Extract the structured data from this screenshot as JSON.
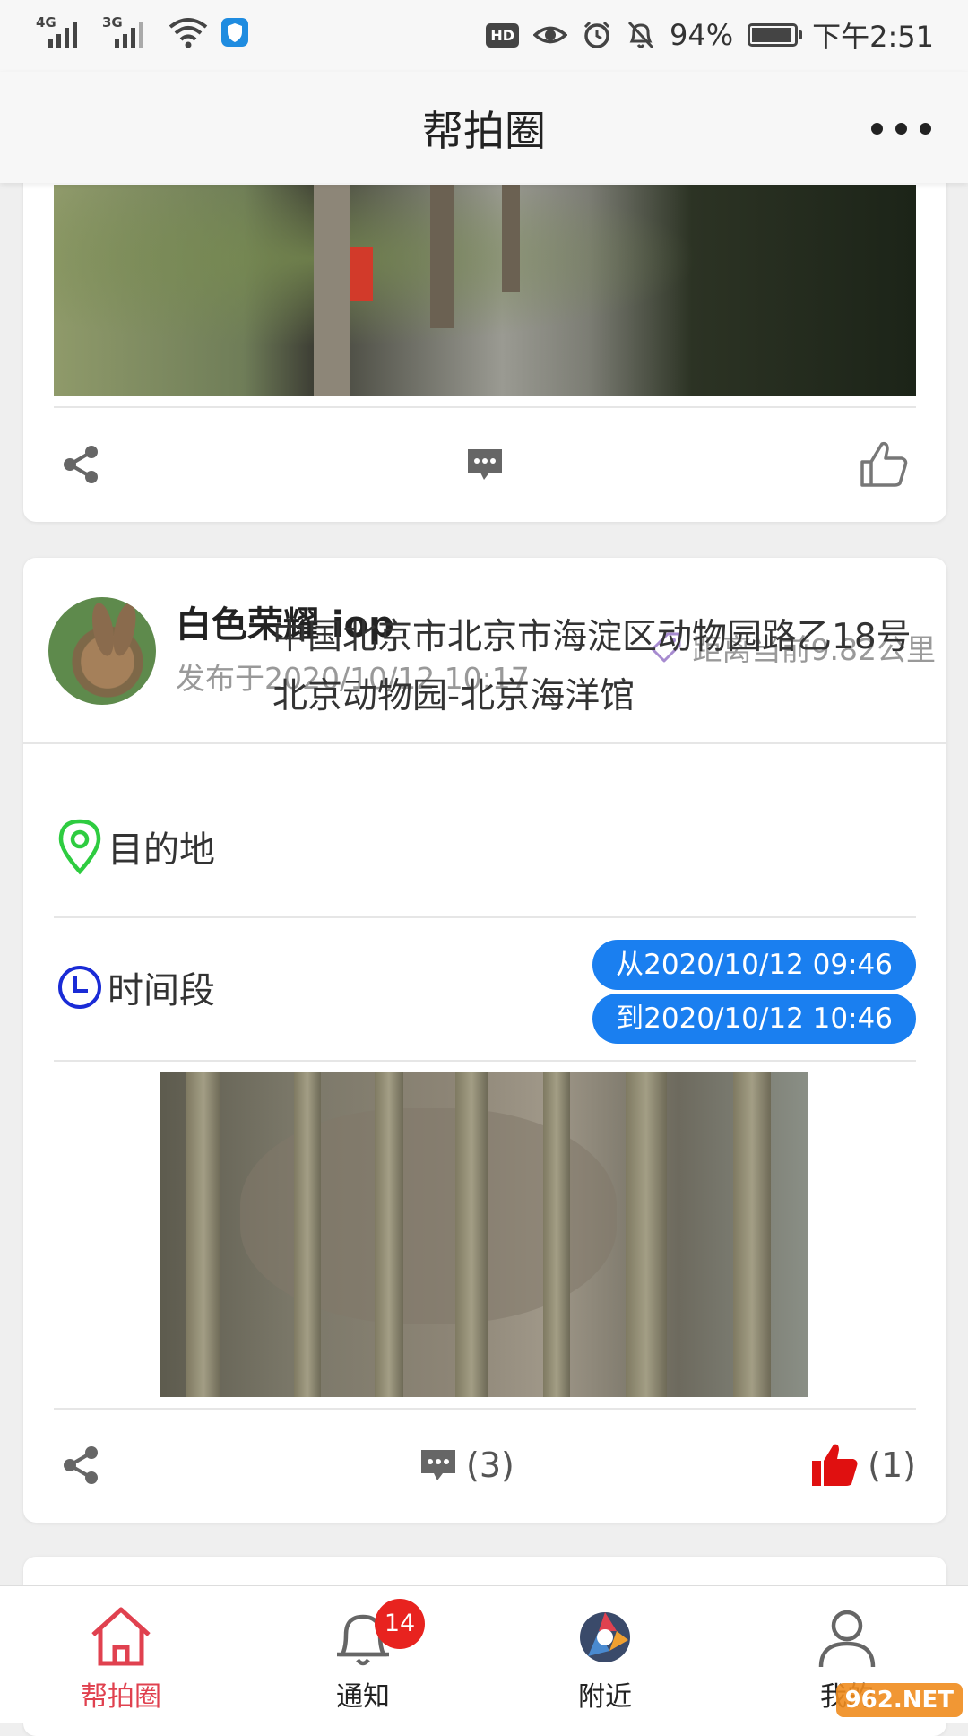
{
  "status_bar": {
    "network1": "4G",
    "network2": "3G",
    "hd": "HD",
    "battery": "94%",
    "battery_level": 0.94,
    "time": "下午2:51"
  },
  "header": {
    "title": "帮拍圈"
  },
  "posts": [
    {
      "actions": {
        "comments": "",
        "likes": ""
      }
    },
    {
      "username": "白色荣耀 iop",
      "posted": "发布于2020/10/12 10:17",
      "distance": "距离当前9.82公里",
      "destination_label": "目的地",
      "destination": "中国北京市北京市海淀区动物园路乙18号北京动物园-北京海洋馆",
      "time_label": "时间段",
      "time_from": "从2020/10/12 09:46",
      "time_to": "到2020/10/12 10:46",
      "comments": "(3)",
      "likes": "(1)"
    }
  ],
  "bottom_nav": {
    "items": [
      {
        "label": "帮拍圈",
        "icon": "home-icon",
        "active": true
      },
      {
        "label": "通知",
        "icon": "bell-icon",
        "badge": "14"
      },
      {
        "label": "附近",
        "icon": "aperture-icon"
      },
      {
        "label": "我的",
        "icon": "user-icon"
      }
    ]
  },
  "watermark": "962.NET",
  "colors": {
    "accent_red": "#e0414f",
    "pill_blue": "#1a7ff0",
    "location_green": "#2ecc40",
    "clock_blue": "#1a2bd6"
  }
}
